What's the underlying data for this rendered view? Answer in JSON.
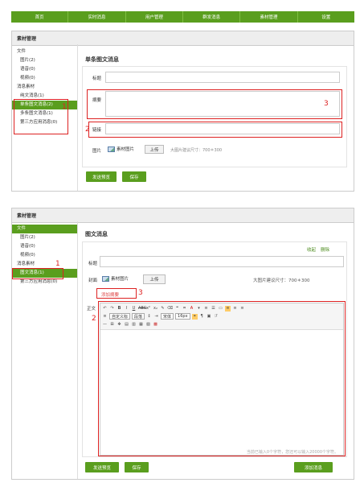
{
  "nav": [
    "首页",
    "实时消息",
    "用户管理",
    "群发消息",
    "素材管理",
    "设置"
  ],
  "p1": {
    "header": "素材管理",
    "sidebar": {
      "cat1": "文件",
      "items1": [
        "图片(2)",
        "语音(0)",
        "视频(0)"
      ],
      "cat2": "消息素材",
      "items2": [
        "纯文消息(1)",
        "单条图文消息(2)",
        "多条图文消息(1)"
      ],
      "items3": [
        "第三方应用消息(0)"
      ]
    },
    "form_title": "单条图文消息",
    "labels": {
      "title": "标题",
      "summary": "摘要",
      "link": "链接",
      "image": "图片"
    },
    "material_image": "素材图片",
    "upload": "上传",
    "size_hint": "大图片建议尺寸：700＊300",
    "btn_preview": "发送预览",
    "btn_save": "保存",
    "num1": "1",
    "num2": "2",
    "num3": "3"
  },
  "p2": {
    "header": "素材管理",
    "sidebar": {
      "cat1": "文件",
      "items1": [
        "图片(2)",
        "语音(0)",
        "视频(0)"
      ],
      "cat2": "消息素材",
      "items2": [
        "图文消息(1)",
        "第三方应用消息(0)"
      ]
    },
    "form_title": "图文消息",
    "collapse": "收起",
    "delete": "删除",
    "labels": {
      "title": "标题",
      "cover": "封面",
      "body": "正文"
    },
    "material_image": "素材图片",
    "upload": "上传",
    "size_hint": "大图片建议尺寸：700＊300",
    "add_summary": "添加摘要",
    "toolbar_selects": [
      "自定义标",
      "段落",
      "宋体",
      "16px"
    ],
    "counter": "当前已输入0个字符，您还可以输入20000个字符。",
    "btn_preview": "发送预览",
    "btn_save": "保存",
    "btn_add": "添加消息",
    "num1": "1",
    "num2": "2",
    "num3": "3"
  }
}
